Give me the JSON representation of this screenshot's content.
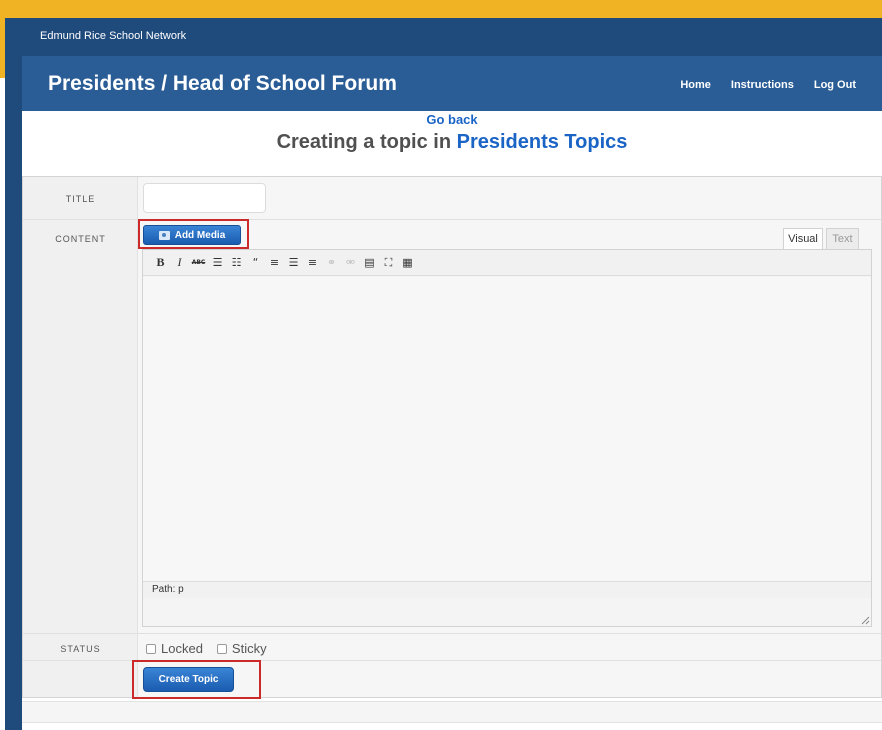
{
  "header": {
    "site_name": "Edmund Rice School Network",
    "forum_title": "Presidents / Head of School Forum",
    "nav": [
      "Home",
      "Instructions",
      "Log Out"
    ]
  },
  "page": {
    "go_back": "Go back",
    "heading_prefix": "Creating a topic in ",
    "forum_name": "Presidents Topics"
  },
  "form": {
    "title_label": "TITLE",
    "title_value": "",
    "content_label": "CONTENT",
    "add_media_label": "Add Media",
    "tabs": [
      "Visual",
      "Text"
    ],
    "active_tab": "Visual",
    "editor_content": "",
    "path_text": "Path: p",
    "status_label": "STATUS",
    "status_options": [
      {
        "label": "Locked",
        "checked": false
      },
      {
        "label": "Sticky",
        "checked": false
      }
    ],
    "submit_label": "Create Topic"
  },
  "toolbar_icons": [
    "bold-icon",
    "italic-icon",
    "strikethrough-icon",
    "bullet-list-icon",
    "numbered-list-icon",
    "blockquote-icon",
    "align-left-icon",
    "align-center-icon",
    "align-right-icon",
    "link-icon",
    "unlink-icon",
    "insert-more-icon",
    "fullscreen-icon",
    "toolbar-toggle-icon"
  ],
  "colors": {
    "gold": "#f0b323",
    "navy": "#1f4a7c",
    "header_blue": "#2a5d96",
    "link_blue": "#1a64c6",
    "button_blue": "#1a5cb0",
    "highlight_red": "#cc2a2a"
  }
}
